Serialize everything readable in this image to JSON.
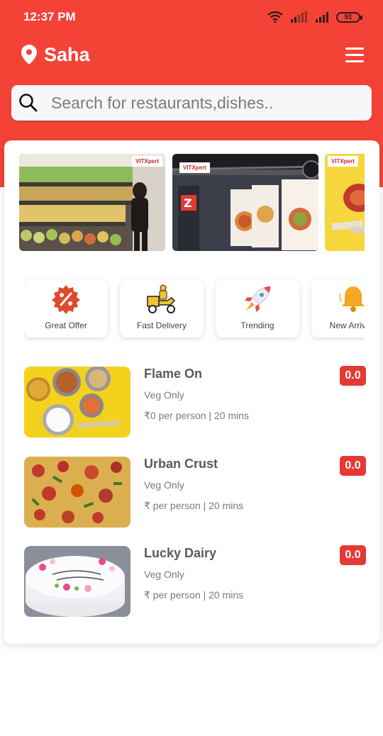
{
  "status_bar": {
    "time": "12:37 PM",
    "battery": "91"
  },
  "app_bar": {
    "location": "Saha",
    "pin_icon": "location-pin-icon",
    "menu_icon": "hamburger-menu-icon"
  },
  "search": {
    "placeholder": "Search for restaurants,dishes.."
  },
  "colors": {
    "brand": "#f44336",
    "rating": "#e53935"
  },
  "banners": [
    {
      "tag": "VITXpert"
    },
    {
      "tag": "VITXpert"
    },
    {
      "tag": "VITXpert"
    }
  ],
  "categories": [
    {
      "label": "Great Offer",
      "icon": "discount-badge-icon"
    },
    {
      "label": "Fast Delivery",
      "icon": "delivery-scooter-icon"
    },
    {
      "label": "Trending",
      "icon": "rocket-icon"
    },
    {
      "label": "New Arrivals",
      "icon": "bell-icon"
    }
  ],
  "restaurants": [
    {
      "name": "Flame On",
      "type": "Veg Only",
      "meta": "₹0 per person | 20 mins",
      "rating": "0.0"
    },
    {
      "name": "Urban Crust",
      "type": "Veg Only",
      "meta": "₹ per person | 20 mins",
      "rating": "0.0"
    },
    {
      "name": "Lucky Dairy",
      "type": "Veg Only",
      "meta": "₹ per person | 20 mins",
      "rating": "0.0"
    }
  ]
}
